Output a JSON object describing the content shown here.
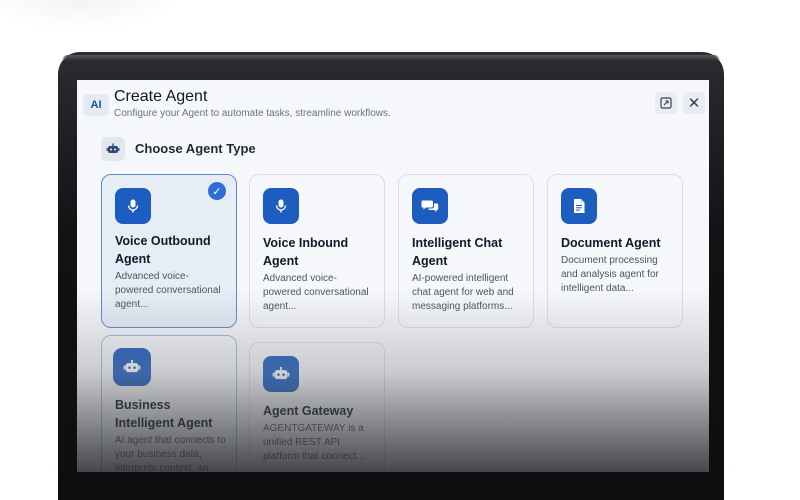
{
  "header": {
    "badge": "AI",
    "title": "Create Agent",
    "subtitle": "Configure your Agent to automate tasks, streamline workflows."
  },
  "actions": {
    "expand_glyph": "⛶",
    "close_glyph": "✕"
  },
  "section": {
    "title": "Choose Agent Type"
  },
  "cards": [
    {
      "title": "Voice Outbound Agent",
      "desc": "Advanced voice-powered conversational agent...",
      "icon": "microphone-icon",
      "selected": true
    },
    {
      "title": "Voice Inbound Agent",
      "desc": "Advanced voice-powered conversational agent...",
      "icon": "microphone-icon",
      "selected": false
    },
    {
      "title": "Intelligent Chat Agent",
      "desc": "AI-powered intelligent chat agent for web and messaging platforms...",
      "icon": "chat-bubbles-icon",
      "selected": false
    },
    {
      "title": "Document Agent",
      "desc": "Document processing and analysis agent for intelligent data...",
      "icon": "document-icon",
      "selected": false
    },
    {
      "title": "Business Intelligent Agent",
      "desc": "AI agent that connects to your business data, interprets context, an...",
      "icon": "robot-icon",
      "selected": false
    },
    {
      "title": "Agent Gateway",
      "desc": "AGENTGATEWAY is a unified REST API platform that connect...",
      "icon": "robot-icon",
      "selected": false
    }
  ],
  "colors": {
    "accent": "#1d5dbf",
    "selected_border": "#5b8bd1",
    "check": "#2f6fd3"
  },
  "check_glyph": "✓"
}
